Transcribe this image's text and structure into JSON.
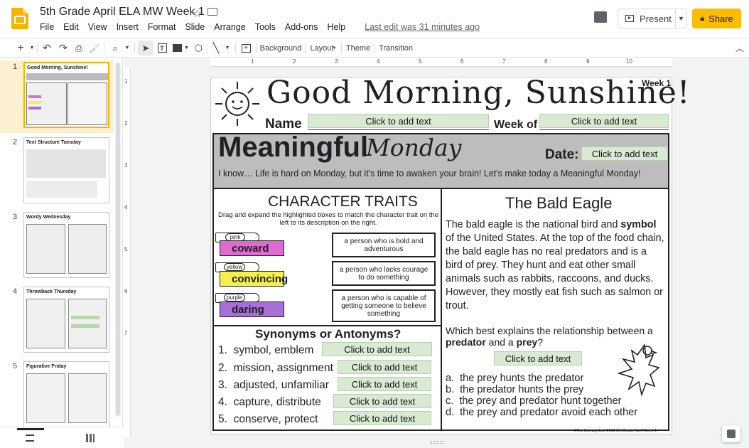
{
  "app": {
    "doc_title": "5th Grade April ELA MW Week 1",
    "menu": [
      "File",
      "Edit",
      "View",
      "Insert",
      "Format",
      "Slide",
      "Arrange",
      "Tools",
      "Add-ons",
      "Help"
    ],
    "last_edit": "Last edit was 31 minutes ago",
    "present_label": "Present",
    "share_label": "Share",
    "accent": "#fbbc04"
  },
  "toolbar": {
    "background": "Background",
    "layout": "Layout",
    "theme": "Theme",
    "transition": "Transition"
  },
  "ruler": [
    "1",
    "1",
    "2",
    "3",
    "4",
    "5",
    "6",
    "7",
    "8",
    "9",
    "10"
  ],
  "ruler_left": [
    "1",
    "2",
    "3",
    "4",
    "5",
    "6",
    "7"
  ],
  "filmstrip": {
    "numbers": [
      "1",
      "2",
      "3",
      "4",
      "5"
    ],
    "thumb_titles": [
      "Good Morning, Sunshine!",
      "Text Structure Tuesday",
      "Wordy Wednesday",
      "Throwback Thursday",
      "Figurative Friday"
    ]
  },
  "slide": {
    "title": "Good Morning, Sunshine!",
    "week_tag": "Week 1",
    "name_label": "Name",
    "week_of_label": "Week of",
    "placeholder": "Click to add text",
    "day_title_a": "Meaningful",
    "day_title_b": "Monday",
    "date_label": "Date:",
    "intro": "I know… Life is hard on Monday, but it's time to awaken your brain!  Let's make today a Meaningful Monday!",
    "traits_title": "CHARACTER TRAITS",
    "traits_instr": "Drag and expand the highlighted boxes to match the character trait on the left to its description on the right.",
    "crayons": [
      {
        "tag": "pink",
        "word": "coward",
        "color": "#e06bd0"
      },
      {
        "tag": "yellow",
        "word": "convincing",
        "color": "#f6f04a"
      },
      {
        "tag": "purple",
        "word": "daring",
        "color": "#a76fd8"
      }
    ],
    "definitions": [
      "a person who is bold and adventurous",
      "a person who lacks courage to do something",
      "a person who is capable of getting someone to believe something"
    ],
    "syn_title": "Synonyms or Antonyms?",
    "syn_items": [
      {
        "num": "1.",
        "text": "symbol, emblem"
      },
      {
        "num": "2.",
        "text": "mission, assignment"
      },
      {
        "num": "3.",
        "text": "adjusted, unfamiliar"
      },
      {
        "num": "4.",
        "text": "capture, distribute"
      },
      {
        "num": "5.",
        "text": "conserve, protect"
      }
    ],
    "eagle_title": "The Bald Eagle",
    "eagle_p1": "The bald eagle is the national bird and ",
    "eagle_bold": "symbol",
    "eagle_p2": " of the United States. At the top of the food chain, the bald eagle has no real predators and is a bird of prey.  They hunt and eat other small animals such as rabbits, raccoons, and ducks.  However, they mostly eat fish such as salmon or trout.",
    "question_a": "Which best explains the relationship between a ",
    "question_b": "predator",
    "question_c": " and a ",
    "question_d": "prey",
    "question_e": "?",
    "choices": [
      {
        "letter": "a.",
        "text": "the prey hunts the predator"
      },
      {
        "letter": "b.",
        "text": "the predator hunts the prey"
      },
      {
        "letter": "c.",
        "text": "the prey and predator hunt together"
      },
      {
        "letter": "d.",
        "text": "the prey and predator avoid each other"
      }
    ],
    "footer": "©The Literacy Loft 2019   5th Grade April Week 1"
  }
}
